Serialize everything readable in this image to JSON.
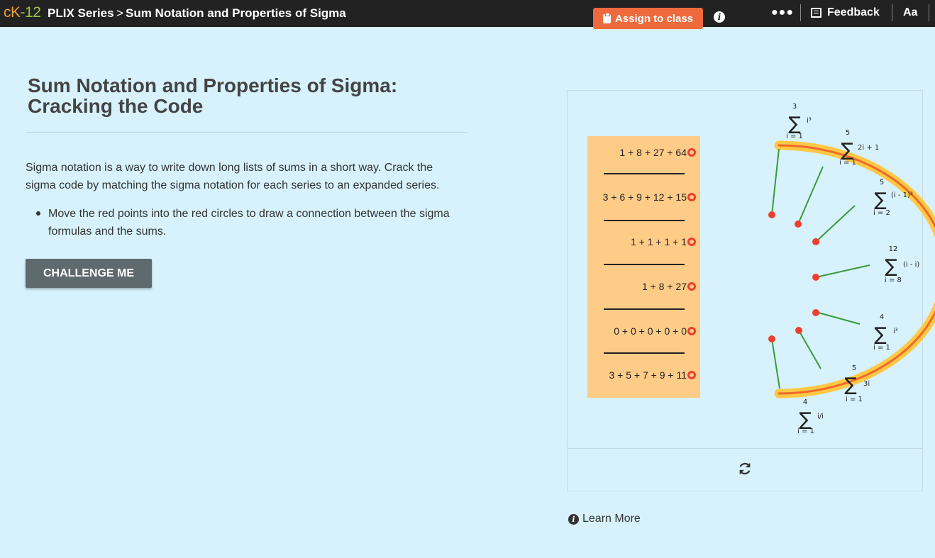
{
  "topbar": {
    "brand_ck": "cK",
    "brand_12": "-12",
    "series": "PLIX Series",
    "separator": ">",
    "page": "Sum Notation and Properties of Sigma",
    "assign_label": "Assign to class",
    "more_label": "●●●",
    "feedback_label": "Feedback",
    "font_label": "Aa",
    "info_label": "i"
  },
  "main": {
    "title": "Sum Notation and Properties of Sigma: Cracking the Code",
    "description": "Sigma notation is a way to write down long lists of sums in a short way. Crack the sigma code by matching the sigma notation for each series to an expanded series.",
    "bullets": [
      "Move the red points into the red circles to draw a connection between the sigma formulas and the sums."
    ],
    "challenge_label": "CHALLENGE ME"
  },
  "interactive": {
    "sums": [
      "1 + 8 + 27 + 64",
      "3 + 6 + 9 + 12 + 15",
      "1 + 1 + 1 + 1",
      "1 + 8 + 27",
      "0 + 0 + 0 + 0 + 0",
      "3 + 5 + 7 + 9 + 11"
    ],
    "sigmas": [
      {
        "top": "3",
        "bottom": "i = 1",
        "term": "i³"
      },
      {
        "top": "5",
        "bottom": "i = 1",
        "term": "2i + 1"
      },
      {
        "top": "5",
        "bottom": "i = 2",
        "term": "(i - 1)³"
      },
      {
        "top": "12",
        "bottom": "i = 8",
        "term": "(i - i)"
      },
      {
        "top": "4",
        "bottom": "i = 1",
        "term": "i³"
      },
      {
        "top": "5",
        "bottom": "i = 1",
        "term": "3i"
      },
      {
        "top": "4",
        "bottom": "i = 1",
        "term": "i/i"
      }
    ],
    "colors": {
      "arc_outer": "#ffc845",
      "arc_inner": "#ee6a2a",
      "connector": "#3a9a3a",
      "point": "#ee3f2d",
      "sum_box": "#ffcc88"
    },
    "refresh_icon": "refresh-icon"
  },
  "footer": {
    "learn_more_label": "Learn More",
    "info_icon": "info-icon"
  }
}
